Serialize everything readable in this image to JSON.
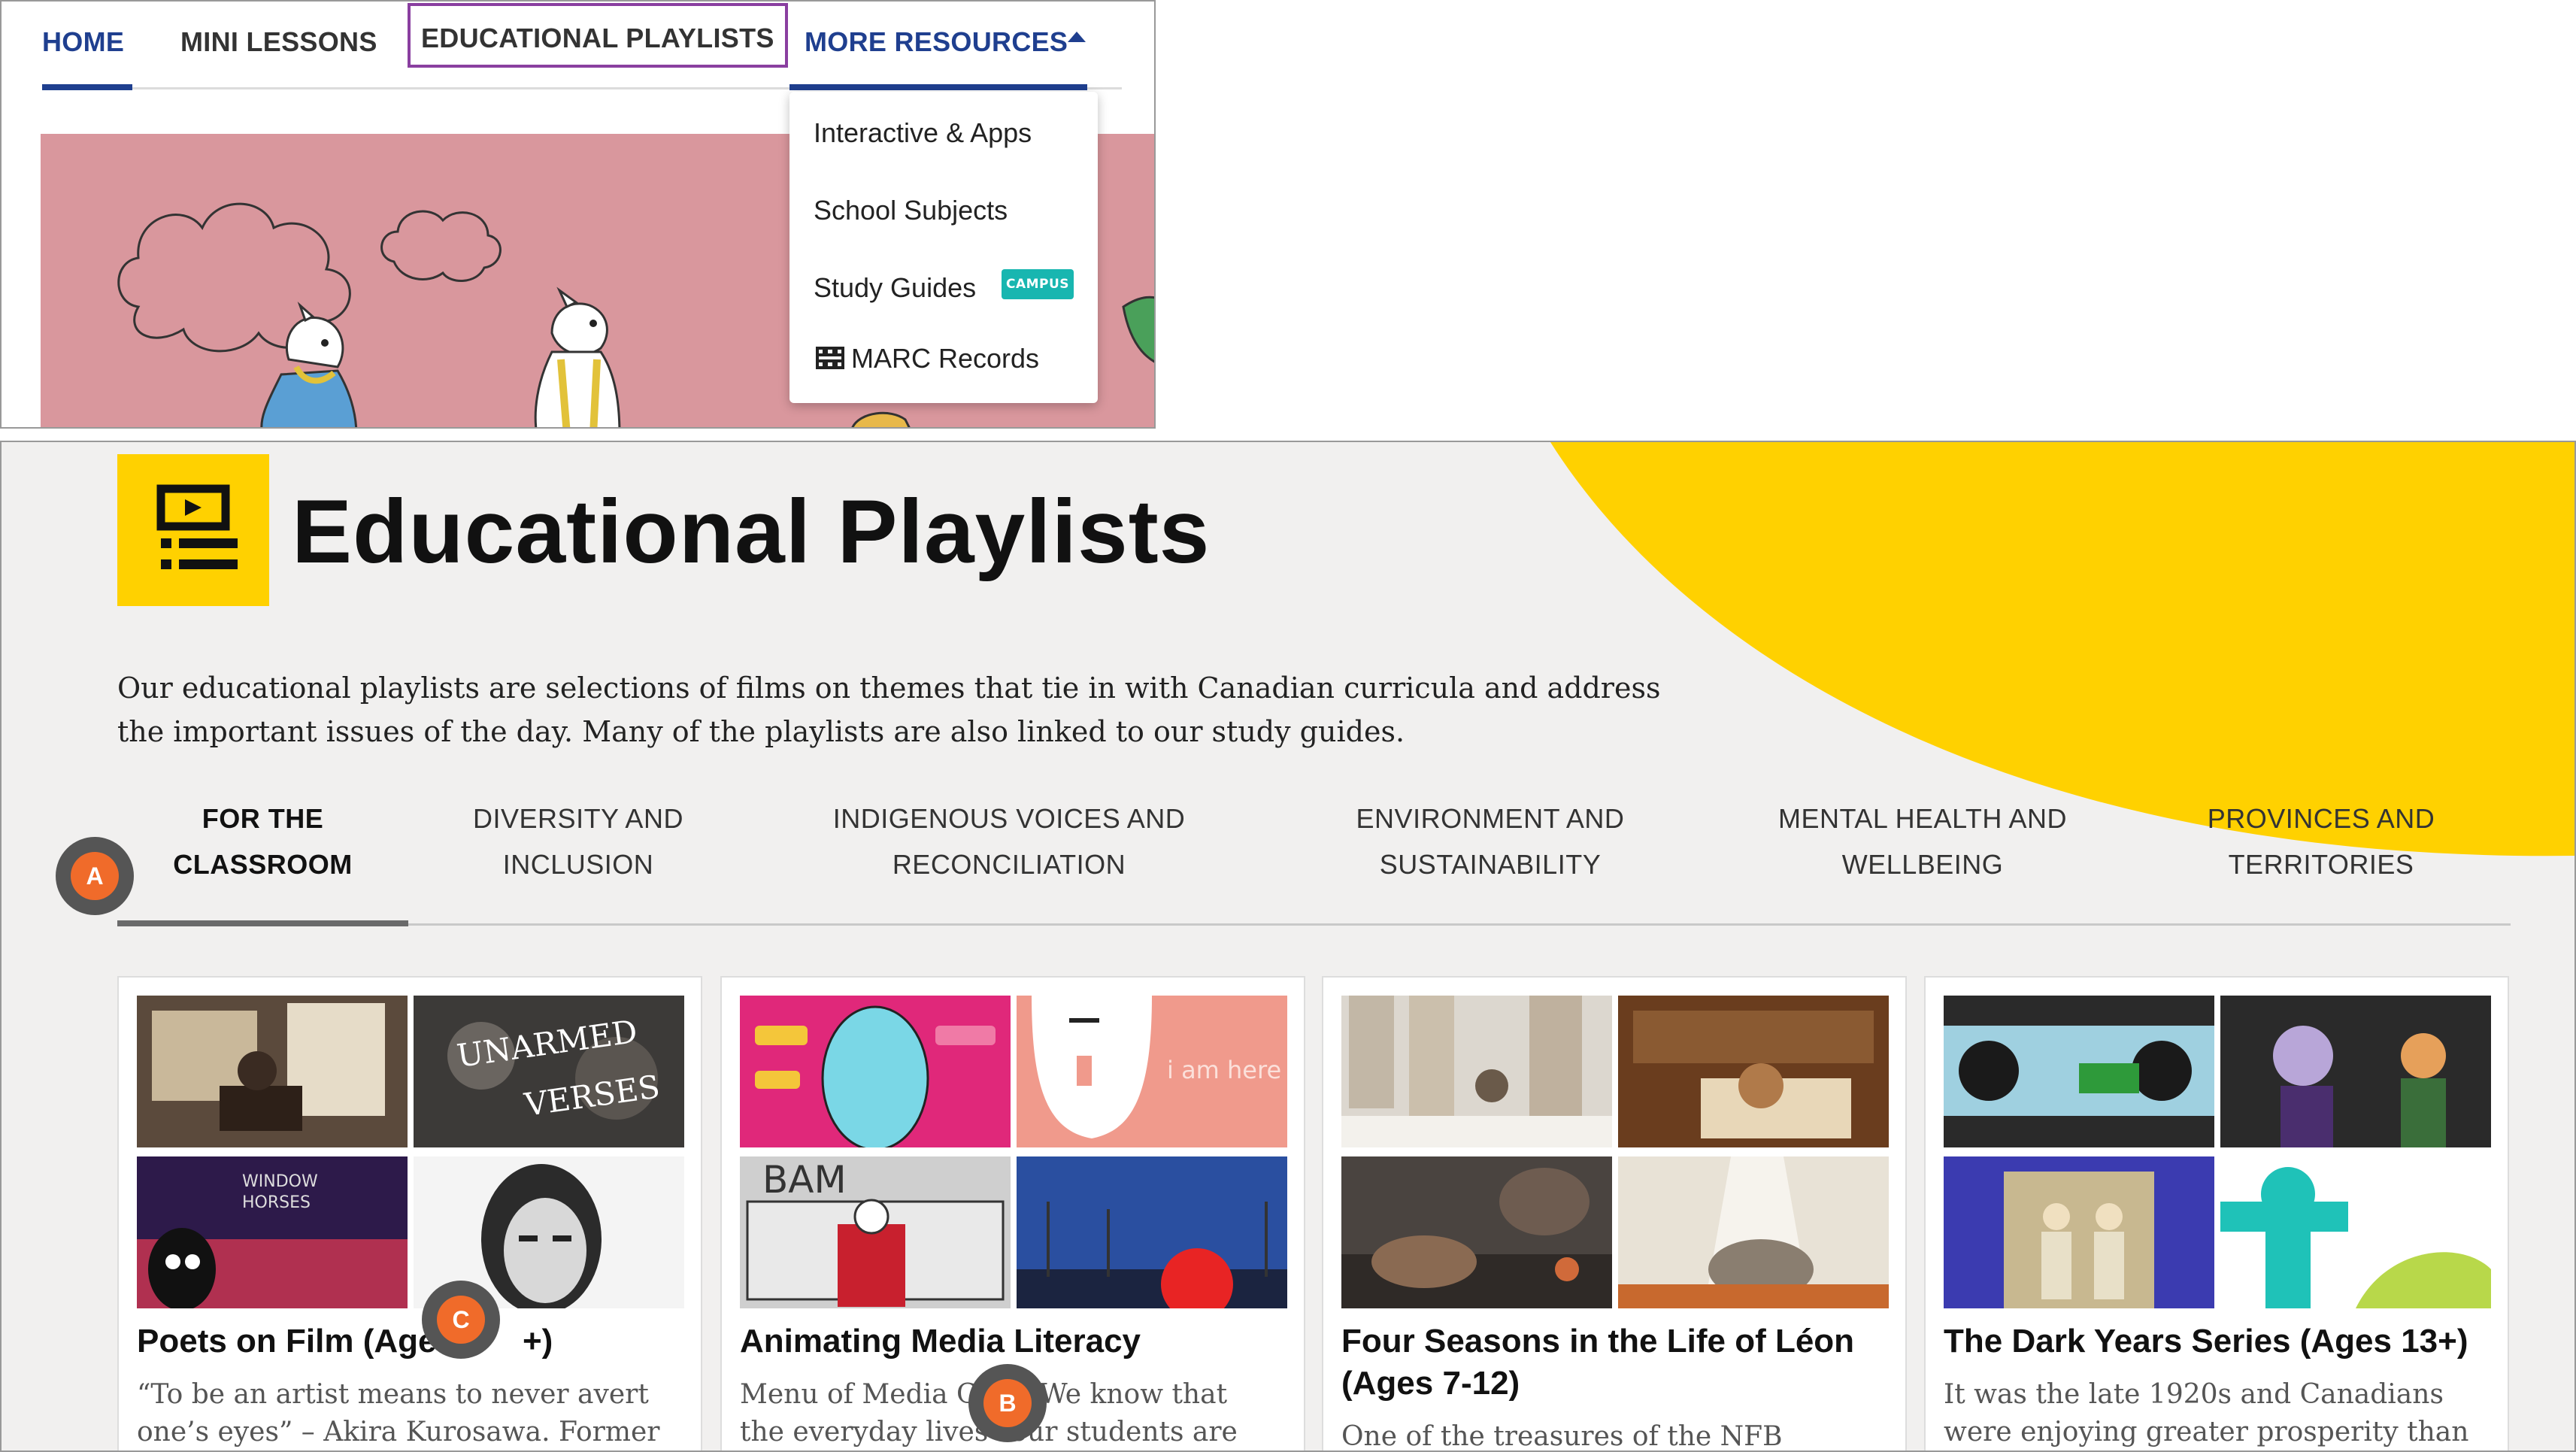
{
  "nav": {
    "home": "HOME",
    "mini_lessons": "MINI LESSONS",
    "educational_playlists": "EDUCATIONAL PLAYLISTS",
    "more_resources": "MORE RESOURCES"
  },
  "dropdown": {
    "items": [
      "Interactive & Apps",
      "School Subjects",
      "Study Guides",
      "MARC Records"
    ],
    "badge": "CAMPUS"
  },
  "page": {
    "title": "Educational Playlists",
    "intro_line1": "Our educational playlists are selections of films on themes that tie in with Canadian curricula and address",
    "intro_line2": "the important issues of the day. Many of the playlists are also linked to our study guides."
  },
  "tabs": [
    {
      "line1": "FOR THE",
      "line2": "CLASSROOM"
    },
    {
      "line1": "DIVERSITY AND",
      "line2": "INCLUSION"
    },
    {
      "line1": "INDIGENOUS VOICES AND",
      "line2": "RECONCILIATION"
    },
    {
      "line1": "ENVIRONMENT AND",
      "line2": "SUSTAINABILITY"
    },
    {
      "line1": "MENTAL HEALTH AND",
      "line2": "WELLBEING"
    },
    {
      "line1": "PROVINCES AND",
      "line2": "TERRITORIES"
    }
  ],
  "cards": [
    {
      "title": "Poets on Film (Ages",
      "title_tail": "+)",
      "desc1": "“To be an artist means to never avert",
      "desc2": "one’s eyes” – Akira Kurosawa. Former",
      "thumb_text": [
        "UNARMED",
        "VERSES",
        "WINDOW",
        "HORSES"
      ]
    },
    {
      "title": "Animating Media Literacy",
      "desc1": "Menu of Media Ch",
      "desc1_tail": "s We know that",
      "desc2": "the everyday lives",
      "desc2_tail": "our students are",
      "thumb_text": [
        "i am here",
        "BAM"
      ]
    },
    {
      "title": "Four Seasons in the Life of Léon",
      "title2": "(Ages 7-12)",
      "desc1": "One of the treasures of the NFB"
    },
    {
      "title": "The Dark Years Series (Ages 13+)",
      "desc1": "It was the late 1920s and Canadians",
      "desc2": "were enjoying greater prosperity than"
    }
  ],
  "markers": {
    "a": "A",
    "b": "B",
    "c": "C"
  },
  "colors": {
    "navy": "#1f3f8f",
    "yellow": "#ffd100",
    "marker": "#f06b2a",
    "badge": "#18b6b0",
    "outline": "#8a3fa0"
  }
}
